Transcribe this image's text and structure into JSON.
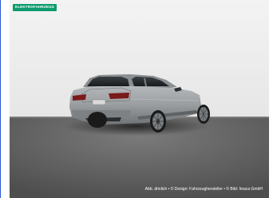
{
  "badge": {
    "label": "ELEKTROFAHRZEUG"
  },
  "caption": {
    "text": "Abb. ähnlich • © Design: Fahrzeughersteller • © Bild: Imaca GmbH"
  },
  "colors": {
    "badge": "#0a9b6e",
    "studio_wall": "#eeeeee",
    "floor": "#5e5e5e",
    "car_body": "#9a9ea0",
    "left_accent": "#2a5bd7"
  },
  "image": {
    "subject": "BMW 5 Series Touring rear three-quarter view in studio"
  }
}
